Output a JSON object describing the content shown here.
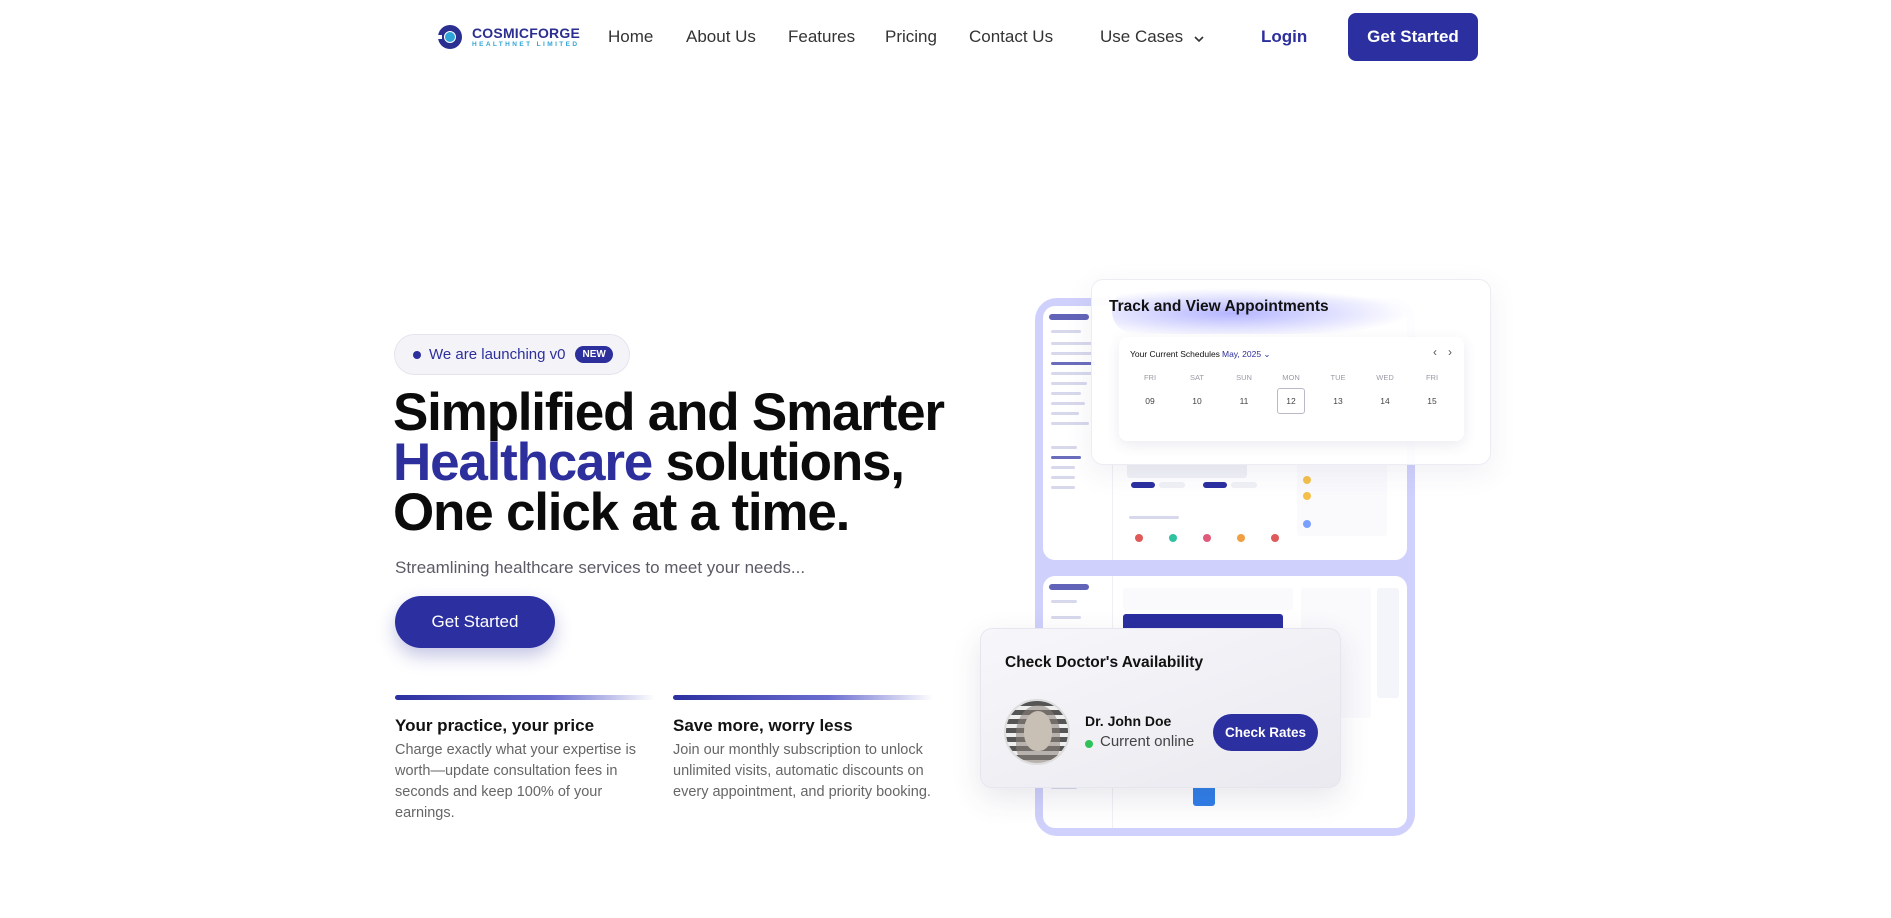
{
  "nav": {
    "brand": "COSMICFORGE",
    "brand_sub": "HEALTHNET LIMITED",
    "links": [
      "Home",
      "About Us",
      "Features",
      "Pricing",
      "Contact Us"
    ],
    "use_cases": "Use Cases",
    "login": "Login",
    "cta": "Get Started"
  },
  "hero": {
    "pill_text": "We are launching v0",
    "pill_badge": "NEW",
    "headline_line1": "Simplified and Smarter",
    "headline_accent": "Healthcare",
    "headline_line2_rest": " solutions,",
    "headline_line3": "One click at a time.",
    "subtext": "Streamlining healthcare services to meet your needs...",
    "cta": "Get Started"
  },
  "features": [
    {
      "title": "Your practice, your price",
      "body": "Charge exactly what your expertise is worth—update consultation fees in seconds and keep 100% of your earnings."
    },
    {
      "title": "Save more, worry less",
      "body": "Join our monthly subscription to unlock unlimited visits, automatic discounts on every appointment, and priority booking."
    }
  ],
  "appointments": {
    "title": "Track and View Appointments",
    "schedule_label": "Your Current Schedules",
    "month": "May, 2025",
    "days": [
      {
        "name": "FRI",
        "date": "09"
      },
      {
        "name": "SAT",
        "date": "10"
      },
      {
        "name": "SUN",
        "date": "11"
      },
      {
        "name": "MON",
        "date": "12"
      },
      {
        "name": "TUE",
        "date": "13"
      },
      {
        "name": "WED",
        "date": "14"
      },
      {
        "name": "FRI",
        "date": "15"
      }
    ],
    "selected_day": "12"
  },
  "doctor_card": {
    "title": "Check Doctor's Availability",
    "doctor_name": "Dr. John Doe",
    "status": "Current online",
    "cta": "Check Rates"
  },
  "colors": {
    "brand": "#2b2f9f",
    "online": "#2fc25b",
    "device_frame": "#cfd0fb"
  }
}
